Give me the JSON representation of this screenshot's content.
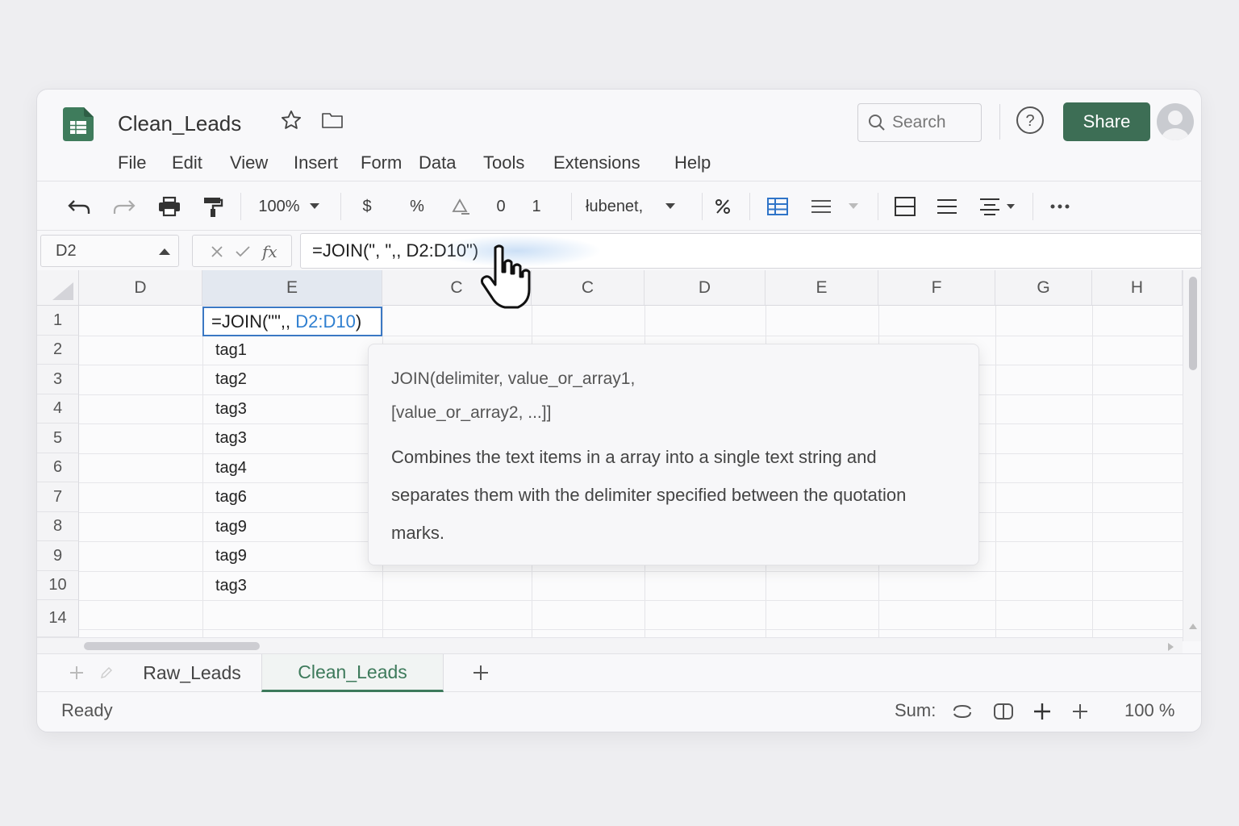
{
  "app": {
    "doc_title": "Clean_Leads",
    "search_placeholder": "Search",
    "share_label": "Share"
  },
  "menu": [
    "File",
    "Edit",
    "View",
    "Insert",
    "Form",
    "Data",
    "Tools",
    "Extensions",
    "Help"
  ],
  "toolbar": {
    "zoom": "100%",
    "currency": "$",
    "percent": "%",
    "dec_decrease": "0",
    "dec_increase": "1",
    "font": "łubenet,"
  },
  "formula_bar": {
    "cell_ref": "D2",
    "fx": "fx",
    "formula": "=JOIN(\", \",, D2:D10\")"
  },
  "grid": {
    "columns": [
      "D",
      "E",
      "C",
      "C",
      "D",
      "E",
      "F",
      "G",
      "H"
    ],
    "rows": [
      "1",
      "2",
      "3",
      "4",
      "5",
      "6",
      "7",
      "8",
      "9",
      "10",
      "14"
    ],
    "active_cell_prefix": "=JOIN(\"\",, ",
    "active_cell_ref": "D2:D10",
    "active_cell_suffix": ")",
    "values": [
      "tag1",
      "tag2",
      "tag3",
      "tag3",
      "tag4",
      "tag6",
      "tag9",
      "tag9",
      "tag3"
    ]
  },
  "tooltip": {
    "signature_line1": "JOIN(delimiter, value_or_array1,",
    "signature_line2": "[value_or_array2, ...]]",
    "description": "Combines the text items in a array into a single text string and separates them with the delimiter specified between the quotation marks."
  },
  "sheets": [
    "Raw_Leads",
    "Clean_Leads"
  ],
  "active_sheet": "Clean_Leads",
  "status": {
    "state": "Ready",
    "sum_label": "Sum:",
    "zoom": "100 %"
  },
  "colors": {
    "brand": "#3d6e55",
    "active_tab": "#3d7a5b",
    "selection": "#3b78c4",
    "range_ref": "#2f7fd0"
  }
}
